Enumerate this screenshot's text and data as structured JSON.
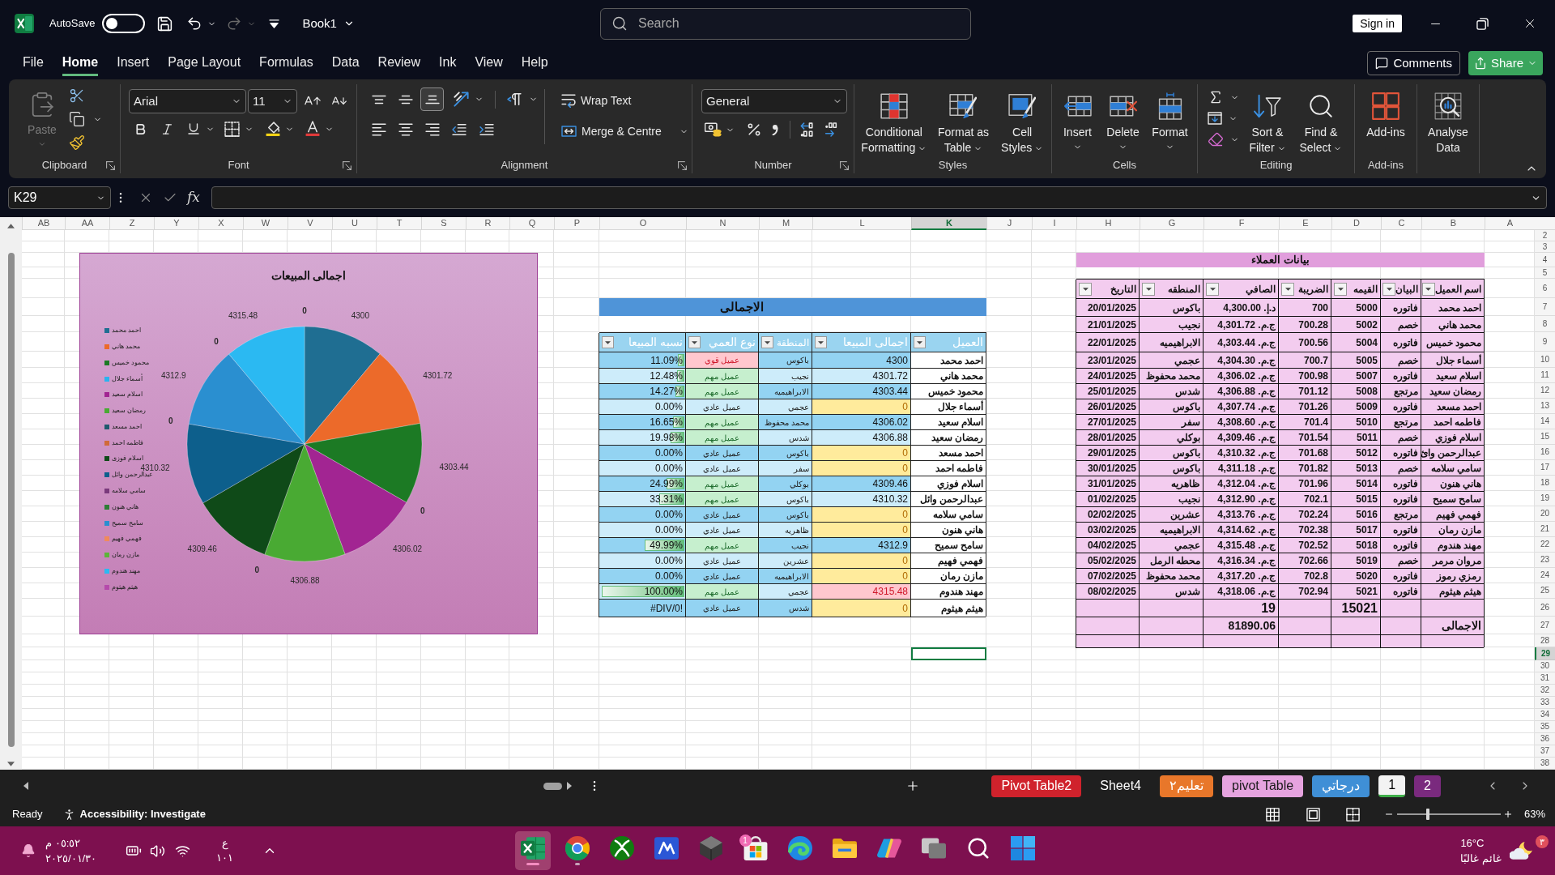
{
  "title_bar": {
    "autosave": {
      "label": "AutoSave",
      "on": false
    },
    "redo_disabled": true,
    "file_name": "Book1",
    "search": {
      "placeholder": "Search"
    },
    "sign_in": "Sign in"
  },
  "menu": {
    "tabs": [
      {
        "label": "Help",
        "selected": false
      },
      {
        "label": "View",
        "selected": false
      },
      {
        "label": "Ink",
        "selected": false
      },
      {
        "label": "Review",
        "selected": false
      },
      {
        "label": "Data",
        "selected": false
      },
      {
        "label": "Formulas",
        "selected": false
      },
      {
        "label": "Page Layout",
        "selected": false
      },
      {
        "label": "Insert",
        "selected": false
      },
      {
        "label": "Home",
        "selected": true
      },
      {
        "label": "File",
        "selected": false
      }
    ],
    "comments": "Comments",
    "share": "Share"
  },
  "ribbon": {
    "clipboard": {
      "label": "Clipboard",
      "paste": {
        "label": "Paste",
        "disabled": true
      }
    },
    "font": {
      "label": "Font",
      "font_name": "Arial",
      "font_size": "11"
    },
    "alignment": {
      "label": "Alignment",
      "vertical": [
        {
          "kind": "top",
          "selected": false
        },
        {
          "kind": "middle",
          "selected": false
        },
        {
          "kind": "bottom",
          "selected": true
        }
      ],
      "wrap_text": "Wrap Text",
      "merge": "Merge & Centre"
    },
    "number": {
      "label": "Number",
      "format": "General"
    },
    "styles": {
      "label": "Styles",
      "buttons": [
        {
          "kind": "cell_styles",
          "label": "Cell Styles"
        },
        {
          "kind": "table",
          "label": "Format as Table"
        },
        {
          "kind": "conditional",
          "label": "Conditional Formatting"
        }
      ]
    },
    "cells": {
      "label": "Cells",
      "buttons": [
        {
          "kind": "format",
          "label": "Format"
        },
        {
          "kind": "delete",
          "label": "Delete"
        },
        {
          "kind": "insert",
          "label": "Insert"
        }
      ]
    },
    "editing": {
      "label": "Editing",
      "buttons": [
        {
          "kind": "find",
          "label": "Find & Select"
        },
        {
          "kind": "sort",
          "label": "Sort & Filter"
        }
      ]
    },
    "add_ins": {
      "label": "Add-ins",
      "buttons": [
        {
          "kind": "add_ins",
          "label": "Add-ins"
        }
      ]
    },
    "analysis": {
      "buttons": [
        {
          "kind": "analyse",
          "label": "Analyse Data"
        }
      ]
    }
  },
  "formula_bar": {
    "name_box": "K29",
    "function_label": "fx"
  },
  "sheet": {
    "columns": [
      {
        "label": "A",
        "selected": false
      },
      {
        "label": "B",
        "selected": false
      },
      {
        "label": "C",
        "selected": false
      },
      {
        "label": "D",
        "selected": false
      },
      {
        "label": "E",
        "selected": false
      },
      {
        "label": "F",
        "selected": false
      },
      {
        "label": "G",
        "selected": false
      },
      {
        "label": "H",
        "selected": false
      },
      {
        "label": "I",
        "selected": false
      },
      {
        "label": "J",
        "selected": false
      },
      {
        "label": "K",
        "selected": true
      },
      {
        "label": "L",
        "selected": false
      },
      {
        "label": "M",
        "selected": false
      },
      {
        "label": "N",
        "selected": false
      },
      {
        "label": "O",
        "selected": false
      },
      {
        "label": "P",
        "selected": false
      },
      {
        "label": "Q",
        "selected": false
      },
      {
        "label": "R",
        "selected": false
      },
      {
        "label": "S",
        "selected": false
      },
      {
        "label": "T",
        "selected": false
      },
      {
        "label": "U",
        "selected": false
      },
      {
        "label": "V",
        "selected": false
      },
      {
        "label": "W",
        "selected": false
      },
      {
        "label": "X",
        "selected": false
      },
      {
        "label": "Y",
        "selected": false
      },
      {
        "label": "Z",
        "selected": false
      },
      {
        "label": "AA",
        "selected": false
      },
      {
        "label": "AB",
        "selected": false
      }
    ],
    "rows": [
      {
        "label": "2",
        "selected": false
      },
      {
        "label": "3",
        "selected": false
      },
      {
        "label": "4",
        "selected": false
      },
      {
        "label": "5",
        "selected": false
      },
      {
        "label": "6",
        "selected": false
      },
      {
        "label": "7",
        "selected": false
      },
      {
        "label": "8",
        "selected": false
      },
      {
        "label": "9",
        "selected": false
      },
      {
        "label": "10",
        "selected": false
      },
      {
        "label": "11",
        "selected": false
      },
      {
        "label": "12",
        "selected": false
      },
      {
        "label": "13",
        "selected": false
      },
      {
        "label": "14",
        "selected": false
      },
      {
        "label": "15",
        "selected": false
      },
      {
        "label": "16",
        "selected": false
      },
      {
        "label": "17",
        "selected": false
      },
      {
        "label": "18",
        "selected": false
      },
      {
        "label": "19",
        "selected": false
      },
      {
        "label": "20",
        "selected": false
      },
      {
        "label": "21",
        "selected": false
      },
      {
        "label": "22",
        "selected": false
      },
      {
        "label": "23",
        "selected": false
      },
      {
        "label": "24",
        "selected": false
      },
      {
        "label": "25",
        "selected": false
      },
      {
        "label": "26",
        "selected": false
      },
      {
        "label": "27",
        "selected": false
      },
      {
        "label": "28",
        "selected": false
      },
      {
        "label": "29",
        "selected": true
      },
      {
        "label": "30",
        "selected": false
      },
      {
        "label": "31",
        "selected": false
      },
      {
        "label": "32",
        "selected": false
      },
      {
        "label": "33",
        "selected": false
      },
      {
        "label": "34",
        "selected": false
      },
      {
        "label": "35",
        "selected": false
      },
      {
        "label": "36",
        "selected": false
      },
      {
        "label": "37",
        "selected": false
      },
      {
        "label": "38",
        "selected": false
      }
    ],
    "customers_table": {
      "title": "بيانات العملاء",
      "headers": [
        "اسم العميل",
        "البيان",
        "القيمه",
        "الضريبة",
        "الصافي",
        "المنطقه",
        "التاريخ"
      ],
      "rows": [
        [
          "احمد محمد",
          "فاتوره",
          "5000",
          "700",
          "د.إ. 4,300.00",
          "باكوس",
          "20/01/2025"
        ],
        [
          "محمد هاني",
          "خصم",
          "5002",
          "700.28",
          "ج.م. 4,301.72",
          "نجيب",
          "21/01/2025"
        ],
        [
          "محمود خميس",
          "فاتوره",
          "5004",
          "700.56",
          "ج.م. 4,303.44",
          "الابراهيميه",
          "22/01/2025"
        ],
        [
          "أسماء جلال",
          "خصم",
          "5005",
          "700.7",
          "ج.م. 4,304.30",
          "عجمي",
          "23/01/2025"
        ],
        [
          "اسلام سعيد",
          "فاتوره",
          "5007",
          "700.98",
          "ج.م. 4,306.02",
          "محمد محفوظ",
          "24/01/2025"
        ],
        [
          "رمضان سعيد",
          "مرتجع",
          "5008",
          "701.12",
          "ج.م. 4,306.88",
          "شدس",
          "25/01/2025"
        ],
        [
          "احمد مسعد",
          "فاتوره",
          "5009",
          "701.26",
          "ج.م. 4,307.74",
          "باكوس",
          "26/01/2025"
        ],
        [
          "فاطمه احمد",
          "مرتجع",
          "5010",
          "701.4",
          "ج.م. 4,308.60",
          "سفر",
          "27/01/2025"
        ],
        [
          "اسلام فوزي",
          "خصم",
          "5011",
          "701.54",
          "ج.م. 4,309.46",
          "بوكلي",
          "28/01/2025"
        ],
        [
          "عبدالرحمن وائ",
          "فاتوره",
          "5012",
          "701.68",
          "ج.م. 4,310.32",
          "باكوس",
          "29/01/2025"
        ],
        [
          "سامي سلامه",
          "خصم",
          "5013",
          "701.82",
          "ج.م. 4,311.18",
          "باكوس",
          "30/01/2025"
        ],
        [
          "هاني هنون",
          "فاتوره",
          "5014",
          "701.96",
          "ج.م. 4,312.04",
          "ظاهريه",
          "31/01/2025"
        ],
        [
          "سامح سميح",
          "فاتوره",
          "5015",
          "702.1",
          "ج.م. 4,312.90",
          "نجيب",
          "01/02/2025"
        ],
        [
          "فهمي فهيم",
          "مرتجع",
          "5016",
          "702.24",
          "ج.م. 4,313.76",
          "عشرين",
          "02/02/2025"
        ],
        [
          "مازن رمان",
          "فاتوره",
          "5017",
          "702.38",
          "ج.م. 4,314.62",
          "الابراهيميه",
          "03/02/2025"
        ],
        [
          "مهند هندوم",
          "فاتوره",
          "5018",
          "702.52",
          "ج.م. 4,315.48",
          "عجمي",
          "04/02/2025"
        ],
        [
          "مروان مرمر",
          "خصم",
          "5019",
          "702.66",
          "ج.م. 4,316.34",
          "محطه الرمل",
          "05/02/2025"
        ],
        [
          "رمزي رموز",
          "فاتوره",
          "5020",
          "702.8",
          "ج.م. 4,317.20",
          "محمد محفوظ",
          "07/02/2025"
        ],
        [
          "هيثم هيثوم",
          "فاتوره",
          "5021",
          "702.94",
          "ج.م. 4,318.06",
          "شدس",
          "08/02/2025"
        ]
      ],
      "count_row": {
        "value": "15021",
        "net": "19"
      },
      "total_row": {
        "label": "الاجمالى",
        "net": "81890.06"
      }
    },
    "summary_table": {
      "title": "الاجمالى",
      "headers": [
        "العميل",
        "اجمالى المبيعا",
        "المنطقة",
        "نوع العمي",
        "نسبه المبيعا"
      ],
      "rows": [
        {
          "customer": "احمد محمد",
          "total": {
            "text": "4300",
            "kind": "plain"
          },
          "region": "باكوس",
          "type": {
            "text": "عميل قوي",
            "kind": "bad"
          },
          "share": {
            "text": "11.09%",
            "level": 0.1109
          }
        },
        {
          "customer": "محمد هاني",
          "total": {
            "text": "4301.72",
            "kind": "plain"
          },
          "region": "نجيب",
          "type": {
            "text": "عميل مهم",
            "kind": "good"
          },
          "share": {
            "text": "12.48%",
            "level": 0.1248
          }
        },
        {
          "customer": "محمود خميس",
          "total": {
            "text": "4303.44",
            "kind": "plain"
          },
          "region": "الابراهيميه",
          "type": {
            "text": "عميل مهم",
            "kind": "good"
          },
          "share": {
            "text": "14.27%",
            "level": 0.1427
          }
        },
        {
          "customer": "أسماء جلال",
          "total": {
            "text": "0",
            "kind": "neutral"
          },
          "region": "عجمي",
          "type": {
            "text": "عميل عادي",
            "kind": "plain"
          },
          "share": {
            "text": "0.00%"
          }
        },
        {
          "customer": "اسلام سعيد",
          "total": {
            "text": "4306.02",
            "kind": "plain"
          },
          "region": "محمد محفوظ",
          "type": {
            "text": "عميل مهم",
            "kind": "good"
          },
          "share": {
            "text": "16.65%",
            "level": 0.1665
          }
        },
        {
          "customer": "رمضان سعيد",
          "total": {
            "text": "4306.88",
            "kind": "plain"
          },
          "region": "شدس",
          "type": {
            "text": "عميل مهم",
            "kind": "good"
          },
          "share": {
            "text": "19.98%",
            "level": 0.1998
          }
        },
        {
          "customer": "احمد مسعد",
          "total": {
            "text": "0",
            "kind": "neutral"
          },
          "region": "باكوس",
          "type": {
            "text": "عميل عادي",
            "kind": "plain"
          },
          "share": {
            "text": "0.00%"
          }
        },
        {
          "customer": "فاطمه احمد",
          "total": {
            "text": "0",
            "kind": "neutral"
          },
          "region": "سفر",
          "type": {
            "text": "عميل عادي",
            "kind": "plain"
          },
          "share": {
            "text": "0.00%"
          }
        },
        {
          "customer": "اسلام فوزي",
          "total": {
            "text": "4309.46",
            "kind": "plain"
          },
          "region": "بوكلي",
          "type": {
            "text": "عميل مهم",
            "kind": "good"
          },
          "share": {
            "text": "24.99%",
            "level": 0.2499
          }
        },
        {
          "customer": "عبدالرحمن وائل",
          "total": {
            "text": "4310.32",
            "kind": "plain"
          },
          "region": "باكوس",
          "type": {
            "text": "عميل مهم",
            "kind": "good"
          },
          "share": {
            "text": "33.31%",
            "level": 0.3331
          }
        },
        {
          "customer": "سامي سلامه",
          "total": {
            "text": "0",
            "kind": "neutral"
          },
          "region": "باكوس",
          "type": {
            "text": "عميل عادي",
            "kind": "plain"
          },
          "share": {
            "text": "0.00%"
          }
        },
        {
          "customer": "هاني هنون",
          "total": {
            "text": "0",
            "kind": "neutral"
          },
          "region": "ظاهريه",
          "type": {
            "text": "عميل عادي",
            "kind": "plain"
          },
          "share": {
            "text": "0.00%"
          }
        },
        {
          "customer": "سامح سميح",
          "total": {
            "text": "4312.9",
            "kind": "plain"
          },
          "region": "نجيب",
          "type": {
            "text": "عميل مهم",
            "kind": "good"
          },
          "share": {
            "text": "49.99%",
            "level": 0.4999
          }
        },
        {
          "customer": "فهمي فهيم",
          "total": {
            "text": "0",
            "kind": "neutral"
          },
          "region": "عشرين",
          "type": {
            "text": "عميل عادي",
            "kind": "plain"
          },
          "share": {
            "text": "0.00%"
          }
        },
        {
          "customer": "مازن رمان",
          "total": {
            "text": "0",
            "kind": "neutral"
          },
          "region": "الابراهيميه",
          "type": {
            "text": "عميل عادي",
            "kind": "plain"
          },
          "share": {
            "text": "0.00%"
          }
        },
        {
          "customer": "مهند هندوم",
          "total": {
            "text": "4315.48",
            "kind": "bad"
          },
          "region": "عجمي",
          "type": {
            "text": "عميل مهم",
            "kind": "good"
          },
          "share": {
            "text": "100.00%",
            "level": 1
          }
        },
        {
          "customer": "هيثم هيثوم",
          "total": {
            "text": "0",
            "kind": "neutral"
          },
          "region": "شدس",
          "type": {
            "text": "عميل عادي",
            "kind": "plain"
          },
          "share": {
            "text": "#DIV/0!"
          }
        }
      ]
    },
    "chart": {
      "chart_data": {
        "type": "pie",
        "title": "اجمالى المبيعات",
        "categories": [
          "احمد محمد",
          "محمد هاني",
          "محمود خميس",
          "أسماء جلال",
          "اسلام سعيد",
          "رمضان سعيد",
          "احمد مسعد",
          "فاطمه احمد",
          "اسلام فوزى",
          "عبدالرحمن وائل",
          "سامي سلامه",
          "هاني هنون",
          "سامح سميح",
          "فهمي فهيم",
          "مازن رمان",
          "مهند هندوم",
          "هيثم هيثوم"
        ],
        "values": [
          4300,
          4301.72,
          4303.44,
          0,
          4306.02,
          4306.88,
          0,
          0,
          4309.46,
          4310.32,
          0,
          0,
          4312.9,
          0,
          0,
          4315.48,
          0
        ],
        "colors": [
          "#1f6e92",
          "#ec6a2a",
          "#1c7a24",
          "#2ab3ef",
          "#a22592",
          "#49aa33",
          "#1f5a6e",
          "#d06a3a",
          "#0f4a18",
          "#0d5f8c",
          "#7a3a7c",
          "#2e7d36",
          "#2a8fd0",
          "#f08a5c",
          "#5db33a",
          "#2bb9f2",
          "#b54aab"
        ],
        "value_labels": [
          "4300",
          "4301.72",
          "4303.44",
          "0",
          "4306.02",
          "4306.88",
          null,
          "0",
          "4309.46",
          "4310.32",
          null,
          "0",
          "4312.9",
          null,
          "0",
          "4315.48",
          "0"
        ],
        "legend": "left"
      }
    }
  },
  "sheet_tabs": [
    {
      "label": "2",
      "color": "#7a2a7e",
      "selected": false
    },
    {
      "label": "1",
      "color": "#3fae49",
      "selected": true
    },
    {
      "label": "درجاتي",
      "color": "#3f8fd6",
      "selected": false
    },
    {
      "label": "pivot Table",
      "color": "#e6a3df",
      "selected": false
    },
    {
      "label": "تعليم٢",
      "color": "#e8772a",
      "selected": false
    },
    {
      "label": "Sheet4",
      "selected": false
    },
    {
      "label": "Pivot Table2",
      "color": "#d0222c",
      "selected": false
    }
  ],
  "status_bar": {
    "status": "Ready",
    "accessibility": "Accessibility: Investigate",
    "zoom": {
      "reading": "63%",
      "level": 0.3
    }
  },
  "taskbar": {
    "clock": {
      "time": "٠٥:٥٢ م",
      "date": "٢٠٢٥/٠١/٣٠"
    },
    "input": {
      "language": "ع",
      "layout": "١٠١"
    },
    "apps": [
      {
        "kind": "spreadsheet",
        "running": true,
        "active": true
      },
      {
        "kind": "browser",
        "running": true,
        "active": false
      },
      {
        "kind": "console",
        "running": false,
        "active": false
      },
      {
        "kind": "editor",
        "running": false,
        "active": false
      },
      {
        "kind": "cube",
        "running": false,
        "active": false
      },
      {
        "kind": "store",
        "running": false,
        "active": false,
        "badge": "1"
      },
      {
        "kind": "swirl",
        "running": false,
        "active": false
      },
      {
        "kind": "folder",
        "running": false,
        "active": false
      },
      {
        "kind": "assistant",
        "running": false,
        "active": false
      },
      {
        "kind": "multitask",
        "running": false,
        "active": false
      },
      {
        "kind": "search",
        "running": false,
        "active": false
      },
      {
        "kind": "start",
        "running": false,
        "active": false
      }
    ],
    "weather": {
      "temperature": "16°C",
      "condition": "غائم غالبًا"
    },
    "notifications": "٣"
  }
}
